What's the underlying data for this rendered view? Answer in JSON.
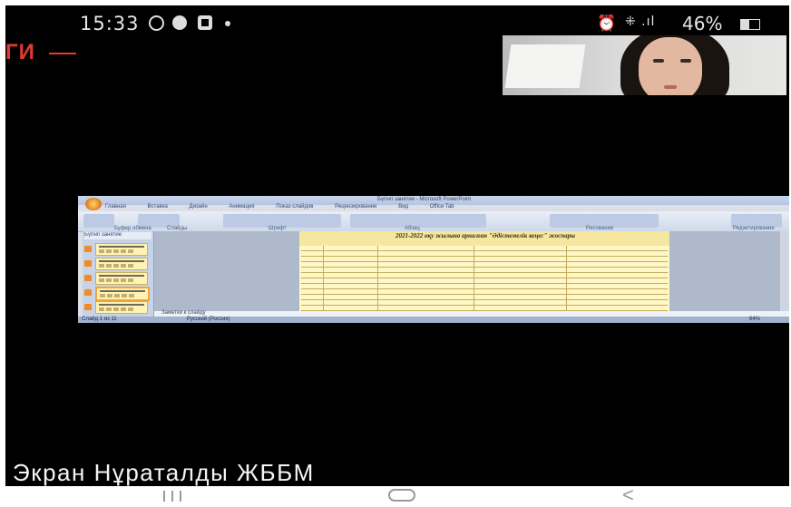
{
  "status_bar": {
    "time": "15:33",
    "battery": "46%",
    "battery_level": 0.46,
    "icons": [
      "whatsapp-icon",
      "chrome-icon",
      "gallery-icon",
      "dot-icon",
      "alarm-icon",
      "wifi-icon",
      "signal-icon",
      "battery-icon"
    ]
  },
  "app": {
    "title_fragment": "ГИ"
  },
  "participant_video": {
    "icon": "participant-camera-tile"
  },
  "shared_screen": {
    "window_title": "Бүгінгі занятие - Microsoft PowerPoint",
    "ribbon_tabs": [
      "Главная",
      "Вставка",
      "Дизайн",
      "Анимация",
      "Показ слайдов",
      "Рецензирование",
      "Вид",
      "Office Tab"
    ],
    "ribbon_groups": [
      "Буфер обмена",
      "Слайды",
      "Шрифт",
      "Абзац",
      "Рисование",
      "Редактирование"
    ],
    "slides_tab": "Бүгінгі занятие",
    "slide_title": "2021-2022 оқу жылына арналған \"Әдістемелік кеңес\" жоспары",
    "notes_placeholder": "Заметки к слайду",
    "status_left": "Слайд 1 из 11",
    "status_mid": "Русский (Россия)",
    "status_right": "64%"
  },
  "caption": {
    "text": "Экран Нұраталды ЖББМ"
  },
  "nav_bar": {
    "icons": [
      "recent-apps-icon",
      "home-icon",
      "back-icon"
    ]
  }
}
